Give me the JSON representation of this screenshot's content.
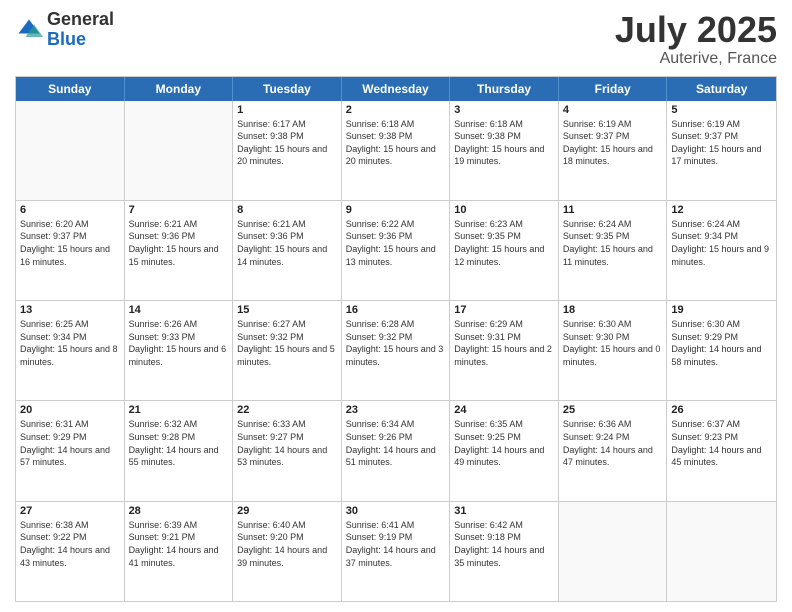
{
  "header": {
    "logo": {
      "general": "General",
      "blue": "Blue"
    },
    "title": "July 2025",
    "location": "Auterive, France"
  },
  "days_of_week": [
    "Sunday",
    "Monday",
    "Tuesday",
    "Wednesday",
    "Thursday",
    "Friday",
    "Saturday"
  ],
  "weeks": [
    [
      {
        "day": "",
        "text": ""
      },
      {
        "day": "",
        "text": ""
      },
      {
        "day": "1",
        "text": "Sunrise: 6:17 AM\nSunset: 9:38 PM\nDaylight: 15 hours and 20 minutes."
      },
      {
        "day": "2",
        "text": "Sunrise: 6:18 AM\nSunset: 9:38 PM\nDaylight: 15 hours and 20 minutes."
      },
      {
        "day": "3",
        "text": "Sunrise: 6:18 AM\nSunset: 9:38 PM\nDaylight: 15 hours and 19 minutes."
      },
      {
        "day": "4",
        "text": "Sunrise: 6:19 AM\nSunset: 9:37 PM\nDaylight: 15 hours and 18 minutes."
      },
      {
        "day": "5",
        "text": "Sunrise: 6:19 AM\nSunset: 9:37 PM\nDaylight: 15 hours and 17 minutes."
      }
    ],
    [
      {
        "day": "6",
        "text": "Sunrise: 6:20 AM\nSunset: 9:37 PM\nDaylight: 15 hours and 16 minutes."
      },
      {
        "day": "7",
        "text": "Sunrise: 6:21 AM\nSunset: 9:36 PM\nDaylight: 15 hours and 15 minutes."
      },
      {
        "day": "8",
        "text": "Sunrise: 6:21 AM\nSunset: 9:36 PM\nDaylight: 15 hours and 14 minutes."
      },
      {
        "day": "9",
        "text": "Sunrise: 6:22 AM\nSunset: 9:36 PM\nDaylight: 15 hours and 13 minutes."
      },
      {
        "day": "10",
        "text": "Sunrise: 6:23 AM\nSunset: 9:35 PM\nDaylight: 15 hours and 12 minutes."
      },
      {
        "day": "11",
        "text": "Sunrise: 6:24 AM\nSunset: 9:35 PM\nDaylight: 15 hours and 11 minutes."
      },
      {
        "day": "12",
        "text": "Sunrise: 6:24 AM\nSunset: 9:34 PM\nDaylight: 15 hours and 9 minutes."
      }
    ],
    [
      {
        "day": "13",
        "text": "Sunrise: 6:25 AM\nSunset: 9:34 PM\nDaylight: 15 hours and 8 minutes."
      },
      {
        "day": "14",
        "text": "Sunrise: 6:26 AM\nSunset: 9:33 PM\nDaylight: 15 hours and 6 minutes."
      },
      {
        "day": "15",
        "text": "Sunrise: 6:27 AM\nSunset: 9:32 PM\nDaylight: 15 hours and 5 minutes."
      },
      {
        "day": "16",
        "text": "Sunrise: 6:28 AM\nSunset: 9:32 PM\nDaylight: 15 hours and 3 minutes."
      },
      {
        "day": "17",
        "text": "Sunrise: 6:29 AM\nSunset: 9:31 PM\nDaylight: 15 hours and 2 minutes."
      },
      {
        "day": "18",
        "text": "Sunrise: 6:30 AM\nSunset: 9:30 PM\nDaylight: 15 hours and 0 minutes."
      },
      {
        "day": "19",
        "text": "Sunrise: 6:30 AM\nSunset: 9:29 PM\nDaylight: 14 hours and 58 minutes."
      }
    ],
    [
      {
        "day": "20",
        "text": "Sunrise: 6:31 AM\nSunset: 9:29 PM\nDaylight: 14 hours and 57 minutes."
      },
      {
        "day": "21",
        "text": "Sunrise: 6:32 AM\nSunset: 9:28 PM\nDaylight: 14 hours and 55 minutes."
      },
      {
        "day": "22",
        "text": "Sunrise: 6:33 AM\nSunset: 9:27 PM\nDaylight: 14 hours and 53 minutes."
      },
      {
        "day": "23",
        "text": "Sunrise: 6:34 AM\nSunset: 9:26 PM\nDaylight: 14 hours and 51 minutes."
      },
      {
        "day": "24",
        "text": "Sunrise: 6:35 AM\nSunset: 9:25 PM\nDaylight: 14 hours and 49 minutes."
      },
      {
        "day": "25",
        "text": "Sunrise: 6:36 AM\nSunset: 9:24 PM\nDaylight: 14 hours and 47 minutes."
      },
      {
        "day": "26",
        "text": "Sunrise: 6:37 AM\nSunset: 9:23 PM\nDaylight: 14 hours and 45 minutes."
      }
    ],
    [
      {
        "day": "27",
        "text": "Sunrise: 6:38 AM\nSunset: 9:22 PM\nDaylight: 14 hours and 43 minutes."
      },
      {
        "day": "28",
        "text": "Sunrise: 6:39 AM\nSunset: 9:21 PM\nDaylight: 14 hours and 41 minutes."
      },
      {
        "day": "29",
        "text": "Sunrise: 6:40 AM\nSunset: 9:20 PM\nDaylight: 14 hours and 39 minutes."
      },
      {
        "day": "30",
        "text": "Sunrise: 6:41 AM\nSunset: 9:19 PM\nDaylight: 14 hours and 37 minutes."
      },
      {
        "day": "31",
        "text": "Sunrise: 6:42 AM\nSunset: 9:18 PM\nDaylight: 14 hours and 35 minutes."
      },
      {
        "day": "",
        "text": ""
      },
      {
        "day": "",
        "text": ""
      }
    ]
  ]
}
